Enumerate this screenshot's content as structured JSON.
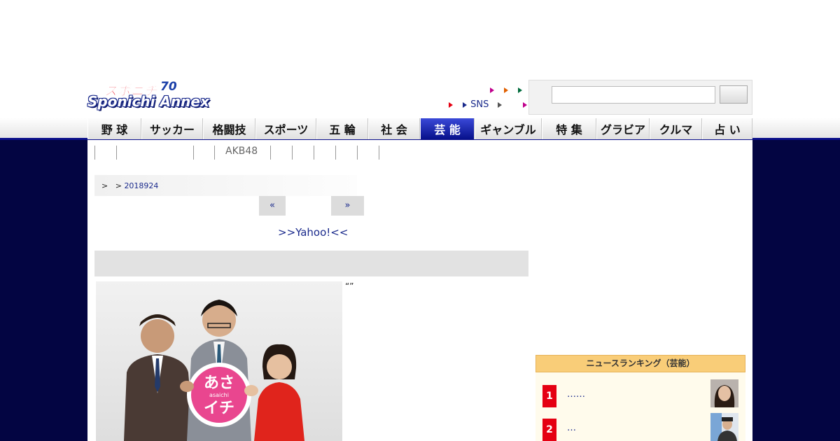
{
  "logo": {
    "top": "スポニチ",
    "main": "Sponichi Annex",
    "badge": "70"
  },
  "util": {
    "row1_arrows": [
      "#c0008c",
      "#e06000",
      "#006b3c"
    ],
    "row2": [
      {
        "color": "#e50012",
        "label": ""
      },
      {
        "color": "#1a2a8c",
        "label": "SNS"
      },
      {
        "color": "#555555",
        "label": ""
      },
      {
        "color": "#c0008c",
        "label": ""
      }
    ]
  },
  "search": {
    "placeholder": "",
    "button": ""
  },
  "nav": {
    "items": [
      {
        "label": "野 球",
        "active": false
      },
      {
        "label": "サッカー",
        "active": false
      },
      {
        "label": "格闘技",
        "active": false
      },
      {
        "label": "スポーツ",
        "active": false
      },
      {
        "label": "五 輪",
        "active": false
      },
      {
        "label": "社 会",
        "active": false
      },
      {
        "label": "芸 能",
        "active": true
      },
      {
        "label": "ギャンブル",
        "active": false
      },
      {
        "label": "特 集",
        "active": false
      },
      {
        "label": "グラビア",
        "active": false
      },
      {
        "label": "クルマ",
        "active": false
      },
      {
        "label": "占 い",
        "active": false
      }
    ]
  },
  "subnav": {
    "items": [
      "",
      "",
      "",
      "AKB48",
      "",
      "",
      "",
      "",
      "",
      ""
    ]
  },
  "breadcrumb": {
    "sep1": ">",
    "sep2": ">",
    "date": "2018924"
  },
  "pager": {
    "prev": "«",
    "next": "»"
  },
  "yahoo_link": ">>Yahoo!<<",
  "article": {
    "quote": "“”",
    "photo_badge": "あさイチ",
    "photo_badge_sub": "asaichi"
  },
  "ranking": {
    "title": "ニュースランキング（芸能）",
    "items": [
      {
        "rank": "1",
        "title": "……"
      },
      {
        "rank": "2",
        "title": "…"
      }
    ]
  }
}
